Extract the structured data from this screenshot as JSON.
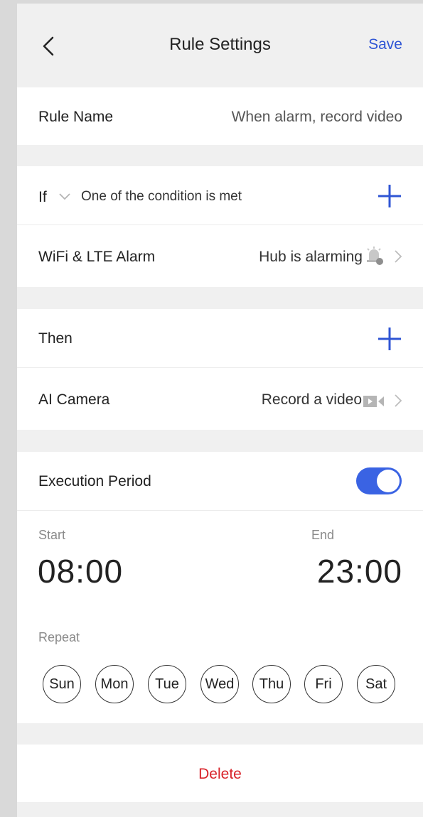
{
  "header": {
    "title": "Rule Settings",
    "save_label": "Save"
  },
  "rule_name": {
    "label": "Rule Name",
    "value": "When alarm, record video"
  },
  "if_section": {
    "if_label": "If",
    "condition_mode": "One of the condition is met"
  },
  "condition": {
    "device": "WiFi & LTE Alarm",
    "state": "Hub is alarming"
  },
  "then_section": {
    "label": "Then"
  },
  "action": {
    "device": "AI Camera",
    "task": "Record a video"
  },
  "execution": {
    "label": "Execution Period",
    "enabled": true,
    "start_label": "Start",
    "start_time": "08:00",
    "end_label": "End",
    "end_time": "23:00",
    "repeat_label": "Repeat",
    "days": [
      "Sun",
      "Mon",
      "Tue",
      "Wed",
      "Thu",
      "Fri",
      "Sat"
    ]
  },
  "delete_label": "Delete",
  "colors": {
    "accent": "#3a63e3",
    "danger": "#d8232a"
  }
}
